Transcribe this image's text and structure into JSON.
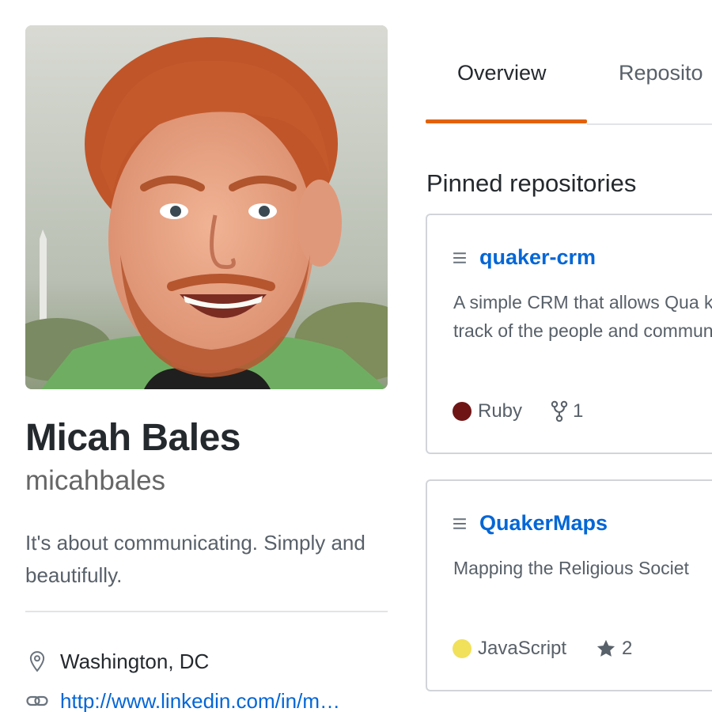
{
  "profile": {
    "full_name": "Micah Bales",
    "username": "micahbales",
    "bio": "It's about communicating. Simply and beautifully.",
    "location": "Washington, DC",
    "website": "http://www.linkedin.com/in/m…"
  },
  "tabs": [
    {
      "label": "Overview",
      "active": true
    },
    {
      "label": "Reposito",
      "active": false
    }
  ],
  "pinned": {
    "title": "Pinned repositories",
    "repos": [
      {
        "name": "quaker-crm",
        "description": "A simple CRM that allows Qua keep track of the people and community.",
        "language": "Ruby",
        "language_color": "#701516",
        "stat_icon": "fork-icon",
        "stat_value": "1"
      },
      {
        "name": "QuakerMaps",
        "description": "Mapping the Religious Societ",
        "language": "JavaScript",
        "language_color": "#f1e05a",
        "stat_icon": "star-icon",
        "stat_value": "2"
      }
    ]
  },
  "colors": {
    "accent_underline": "#e36209",
    "link": "#0366d6",
    "border": "#d1d5da"
  }
}
